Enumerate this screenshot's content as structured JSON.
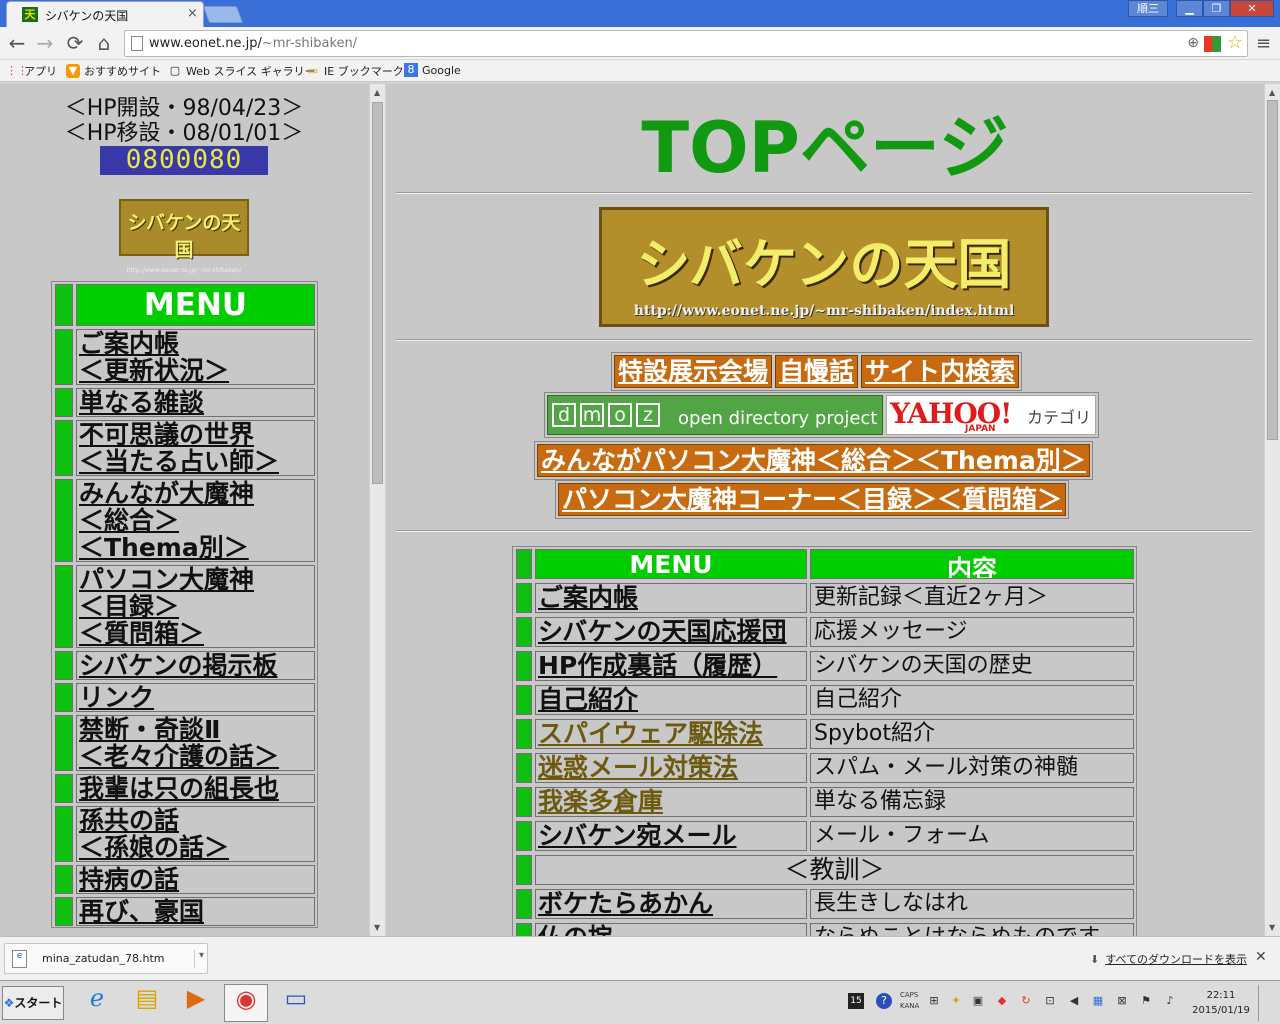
{
  "browser": {
    "tab_title": "シバケンの天国",
    "tab_favicon": "天",
    "tab_close": "×",
    "user_label": "順三",
    "win_min": "▁",
    "win_max": "❐",
    "win_close": "✕",
    "url_host": "www.eonet.ne.jp/",
    "url_path": "~mr-shibaken/",
    "back": "←",
    "forward": "→",
    "reload": "⟳",
    "home": "⌂",
    "zoom_icon": "⊕",
    "star_icon": "☆",
    "menu_icon": "≡"
  },
  "bookmarks": [
    {
      "label": "アプリ",
      "icon": "⋮⋮"
    },
    {
      "label": "おすすめサイト",
      "icon": "▼"
    },
    {
      "label": "Web スライス ギャラリー",
      "icon": "▢"
    },
    {
      "label": "IE ブックマーク",
      "icon": "▭"
    },
    {
      "label": "Google",
      "icon": "8"
    }
  ],
  "left": {
    "opened": "＜HP開設・98/04/23＞",
    "moved": "＜HP移設・08/01/01＞",
    "counter": "0800080",
    "logo_text": "シバケンの天国",
    "logo_url": "http://www.eonet.ne.jp/~mr-shibaken/",
    "menu_head": "MENU",
    "menu": [
      "ご案内帳\n＜更新状況＞",
      "単なる雑談",
      "不可思議の世界\n＜当たる占い師＞",
      "みんなが大魔神\n＜総合＞\n＜Thema別＞",
      "パソコン大魔神\n＜目録＞\n＜質問箱＞",
      "シバケンの掲示板",
      "リンク",
      "禁断・奇談Ⅱ\n＜老々介護の話＞",
      "我輩は只の組長也",
      "孫共の話\n＜孫娘の話＞",
      "持病の話",
      "再び、豪国"
    ]
  },
  "main": {
    "title": "TOPページ",
    "logo_text": "シバケンの天国",
    "logo_url": "http://www.eonet.ne.jp/~mr-shibaken/index.html",
    "links_row1": [
      "特設展示会場",
      "自慢話",
      "サイト内検索"
    ],
    "dmoz_letters": [
      "d",
      "m",
      "o",
      "z"
    ],
    "dmoz_text": "open directory project",
    "yahoo_logo": "YAHOO!",
    "yahoo_japan": "JAPAN",
    "yahoo_category": "カテゴリ",
    "link_minna": "みんながパソコン大魔神＜総合＞＜Thema別＞",
    "link_pasokon": "パソコン大魔神コーナー＜目録＞＜質問箱＞",
    "table_head": [
      "MENU",
      "内容"
    ],
    "rows": [
      {
        "menu": "ご案内帳",
        "desc": "更新記録＜直近2ヶ月＞",
        "visited": false
      },
      {
        "menu": "シバケンの天国応援団",
        "desc": "応援メッセージ",
        "visited": false
      },
      {
        "menu": "HP作成裏話（履歴）",
        "desc": "シバケンの天国の歴史",
        "visited": false
      },
      {
        "menu": "自己紹介",
        "desc": "自己紹介",
        "visited": false
      },
      {
        "menu": "スパイウェア駆除法",
        "desc": "Spybot紹介",
        "visited": true
      },
      {
        "menu": "迷惑メール対策法",
        "desc": "スパム・メール対策の神髄",
        "visited": true
      },
      {
        "menu": "我楽多倉庫",
        "desc": "単なる備忘録",
        "visited": true
      },
      {
        "menu": "シバケン宛メール",
        "desc": "メール・フォーム",
        "visited": false
      }
    ],
    "section_label": "＜教訓＞",
    "rows2": [
      {
        "menu": "ボケたらあかん",
        "desc": "長生きしなはれ"
      },
      {
        "menu": "仏の掟",
        "desc": "ならぬことはならぬものです"
      }
    ]
  },
  "download": {
    "file": "mina_zatudan_78.htm",
    "show_all": "すべてのダウンロードを表示",
    "close": "✕"
  },
  "taskbar": {
    "start": "スタート",
    "caps": "CAPS",
    "kana": "KANA",
    "time": "22:11",
    "date": "2015/01/19"
  }
}
